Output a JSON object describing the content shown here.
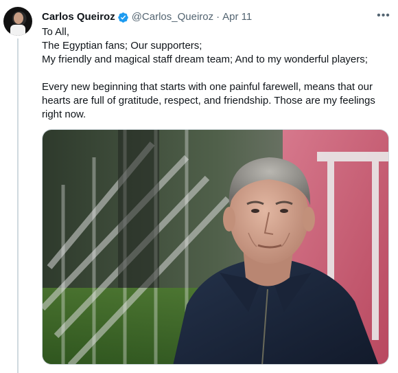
{
  "author": {
    "name": "Carlos Queiroz",
    "handle": "@Carlos_Queiroz",
    "separator": "·",
    "date": "Apr 11",
    "verified": true
  },
  "icons": {
    "avatar": "profile-photo",
    "verified": "verified-badge-icon",
    "more": "more-options-icon"
  },
  "more_glyph": "•••",
  "text": {
    "line1": "To All,",
    "line2": "The Egyptian fans; Our supporters;",
    "line3": "My friendly and magical staff dream team; And to my wonderful players;",
    "line4": "Every new beginning that starts with one painful farewell, means that our",
    "line5": "hearts are full of gratitude, respect, and friendship. Those are my feelings",
    "line6": "right now."
  },
  "colors": {
    "verified": "#1d9bf0",
    "secondary_text": "#536471",
    "primary_text": "#0f1419",
    "thread_line": "#cfd9de"
  }
}
